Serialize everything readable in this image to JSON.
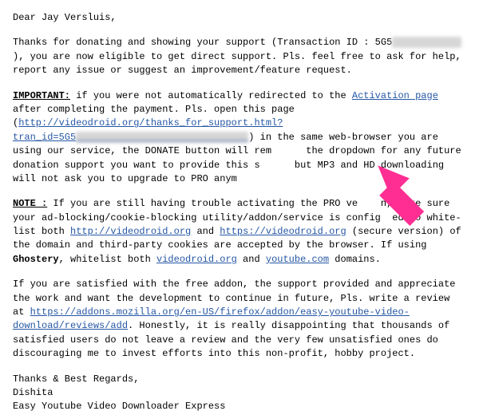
{
  "greeting": "Dear Jay Versluis,",
  "para1_a": "Thanks for donating and showing your support (Transaction ID : 5G5",
  "para1_mask": "XXXXXXXXXXXX",
  "para1_b": " ), you are now eligible to get direct support. Pls. feel free to ask for help, report any issue or suggest an improvement/feature request.",
  "important_label": "IMPORTANT:",
  "imp_a": " if you were not automatically redirected to the ",
  "imp_link1": "Activation page",
  "imp_b": " after completing the payment. Pls. open this page (",
  "imp_link2a": "http://videodroid.org/thanks_for_support.html?tran_id=5G5",
  "imp_link2_mask": "XXXXXXXXXXXXXXXXXXXXXXXXXXXXXX",
  "imp_c": ") in the same web-browser you are using our service, the DONATE button will rem",
  "imp_c2": "the dropdown for any future donation support you want to provide this s",
  "imp_c3": "but MP3 and HD downloading will not ask you to upgrade to PRO anym",
  "note_label": "NOTE :",
  "note_a": " If you are still having trouble activating the PRO ve",
  "note_a2": "n, make sure your ad-blocking/cookie-blocking utility/addon/service is config",
  "note_a3": "ed to white-list both ",
  "note_link1": "http://videodroid.org",
  "note_b": " and ",
  "note_link2": "https://videodroid.org",
  "note_c": " (secure version) of the domain and third-party cookies are accepted by the browser. If using ",
  "note_ghost": "Ghostery",
  "note_d": ", whitelist both ",
  "note_link3": "videodroid.org",
  "note_e": " and ",
  "note_link4": "youtube.com",
  "note_f": " domains.",
  "sat_a": "If you are satisfied with the free addon, the support provided and appreciate the work and want the development to continue in future, Pls. write a review at ",
  "sat_link": "https://addons.mozilla.org/en-US/firefox/addon/easy-youtube-video-download/reviews/add",
  "sat_b": ". Honestly, it is really disappointing that thousands of satisfied users do not leave a review and the very few unsatisfied ones do discouraging me to invest efforts into this non-profit, hobby project.",
  "signoff1": "Thanks & Best Regards,",
  "signoff2": "Dishita",
  "signoff3": "Easy Youtube Video Downloader Express",
  "arrow_color": "#ff2e92"
}
